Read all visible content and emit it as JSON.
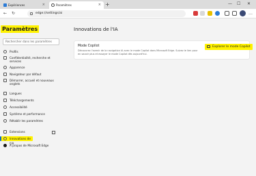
{
  "browser": {
    "tabs": [
      {
        "label": "Expériences"
      },
      {
        "label": "Paramètres"
      }
    ],
    "new_tab": "+",
    "tab_close": "×",
    "address": "edge://settings/ai",
    "window_controls": {
      "minimize": "—",
      "maximize": "☐",
      "close": "✕"
    },
    "nav": {
      "back": "←",
      "refresh": "↻"
    }
  },
  "sidebar": {
    "title": "Paramètres",
    "search_placeholder": "Rechercher dans les paramètres",
    "items": [
      {
        "label": "Profils",
        "icon": "profile-icon"
      },
      {
        "label": "Confidentialité, recherche et services",
        "icon": "lock-icon"
      },
      {
        "label": "Apparence",
        "icon": "appearance-icon"
      },
      {
        "label": "Navigateur par défaut",
        "icon": "browser-icon"
      },
      {
        "label": "Démarrer, accueil et nouveaux onglets",
        "icon": "home-icon"
      },
      {
        "label": "Langues",
        "icon": "language-icon"
      },
      {
        "label": "Téléchargements",
        "icon": "download-icon"
      },
      {
        "label": "Accessibilité",
        "icon": "accessibility-icon"
      },
      {
        "label": "Système et performance",
        "icon": "system-icon"
      },
      {
        "label": "Rétablir les paramètres",
        "icon": "reset-icon"
      },
      {
        "label": "Extensions",
        "icon": "extensions-icon"
      },
      {
        "label": "Innovations de l'IA",
        "icon": "ai-icon",
        "active": true
      },
      {
        "label": "À propos de Microsoft Edge",
        "icon": "edge-icon"
      }
    ]
  },
  "main": {
    "title": "Innovations de l'IA",
    "card": {
      "title": "Mode Copilot",
      "description": "Découvrez l'avenir de la navigation IA avec le mode Copilot dans Microsoft Edge. Suivez le lien pour en savoir plus et essayer le mode Copilot dès aujourd'hui.",
      "button_label": "Explorer le mode Copilot"
    }
  },
  "colors": {
    "highlight": "#fff200",
    "accent": "#0f6cbd"
  }
}
